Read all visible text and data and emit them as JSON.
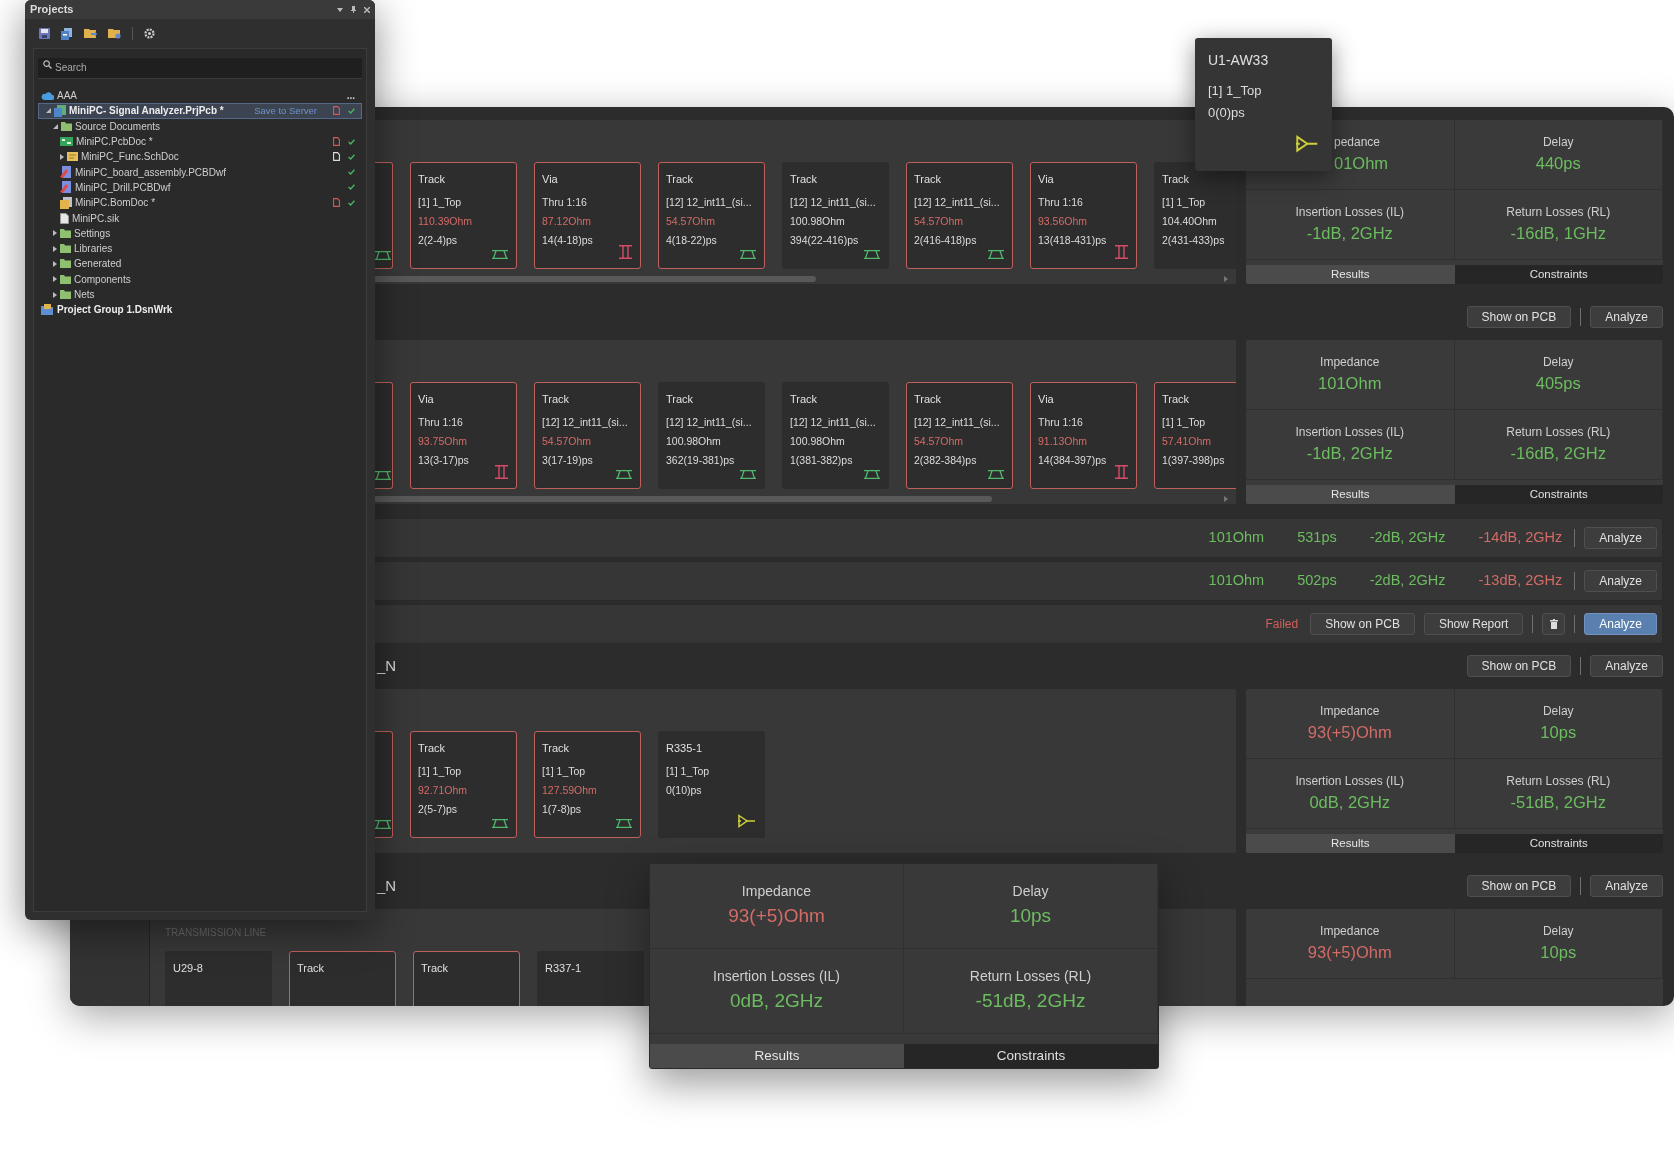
{
  "projects": {
    "title": "Projects",
    "search": {
      "placeholder": "Search"
    },
    "tree": [
      {
        "label": "AAA",
        "kind": "workspace",
        "selected": false,
        "more": "...",
        "children": [
          {
            "label": "MiniPC- Signal Analyzer.PrjPcb *",
            "kind": "project",
            "expanded": true,
            "selected": true,
            "action": "Save to Server",
            "modified": true,
            "synced": true,
            "children": [
              {
                "label": "Source Documents",
                "kind": "folder",
                "expanded": true,
                "selected": false,
                "children": [
                  {
                    "label": "MiniPC.PcbDoc *",
                    "kind": "pcb",
                    "selected": false,
                    "modified": true,
                    "synced": true
                  },
                  {
                    "label": "MiniPC_Func.SchDoc",
                    "kind": "schematic",
                    "expanded": false,
                    "selected": false,
                    "modified": false,
                    "synced": true
                  },
                  {
                    "label": "MiniPC_board_assembly.PCBDwf",
                    "kind": "drawing",
                    "selected": false,
                    "synced": true
                  },
                  {
                    "label": "MiniPC_Drill.PCBDwf",
                    "kind": "drawing",
                    "selected": false,
                    "synced": true
                  },
                  {
                    "label": "MiniPC.BomDoc *",
                    "kind": "bom",
                    "selected": false,
                    "modified": true,
                    "synced": true
                  },
                  {
                    "label": "MiniPC.sik",
                    "kind": "text",
                    "selected": false,
                    "synced": false
                  }
                ]
              },
              {
                "label": "Settings",
                "kind": "folder",
                "expanded": false,
                "selected": false
              },
              {
                "label": "Libraries",
                "kind": "folder",
                "expanded": false,
                "selected": false
              },
              {
                "label": "Generated",
                "kind": "folder",
                "expanded": false,
                "selected": false
              },
              {
                "label": "Components",
                "kind": "folder",
                "expanded": false,
                "selected": false
              },
              {
                "label": "Nets",
                "kind": "folder",
                "expanded": false,
                "selected": false
              }
            ]
          }
        ]
      },
      {
        "label": "Project Group 1.DsnWrk",
        "kind": "group",
        "selected": false
      }
    ]
  },
  "sections": [
    {
      "kind": "detail",
      "scrollbar": true,
      "cards": [
        {
          "cut": true,
          "flagged": true,
          "kind": "track"
        },
        {
          "title": "Track",
          "layer": "[1] 1_Top",
          "impedance": "110.39Ohm",
          "delay": "2(2-4)ps",
          "flagged": true,
          "kind": "track"
        },
        {
          "title": "Via",
          "layer": "Thru 1:16",
          "impedance": "87.12Ohm",
          "delay": "14(4-18)ps",
          "flagged": true,
          "kind": "via"
        },
        {
          "title": "Track",
          "layer": "[12] 12_int11_(si...",
          "impedance": "54.57Ohm",
          "delay": "4(18-22)ps",
          "flagged": true,
          "kind": "track"
        },
        {
          "title": "Track",
          "layer": "[12] 12_int11_(si...",
          "impedance": "100.98Ohm",
          "delay": "394(22-416)ps",
          "flagged": false,
          "kind": "track"
        },
        {
          "title": "Track",
          "layer": "[12] 12_int11_(si...",
          "impedance": "54.57Ohm",
          "delay": "2(416-418)ps",
          "flagged": true,
          "kind": "track"
        },
        {
          "title": "Via",
          "layer": "Thru 1:16",
          "impedance": "93.56Ohm",
          "delay": "13(418-431)ps",
          "flagged": true,
          "kind": "via"
        },
        {
          "title": "Track",
          "layer": "[1] 1_Top",
          "impedance": "104.40Ohm",
          "delay": "2(431-433)ps",
          "flagged": false
        }
      ],
      "results": {
        "metrics": [
          {
            "label": "pedance",
            "value": "01Ohm",
            "failed": false,
            "covered": true
          },
          {
            "label": "Delay",
            "value": "440ps",
            "failed": false,
            "covered": false
          },
          {
            "label": "Insertion Losses (IL)",
            "value": "-1dB, 2GHz",
            "failed": false,
            "covered": false
          },
          {
            "label": "Return Losses (RL)",
            "value": "-16dB, 1GHz",
            "failed": false,
            "covered": false
          }
        ],
        "tabs": [
          {
            "label": "Results",
            "selected": true
          },
          {
            "label": "Constraints",
            "selected": false
          }
        ]
      }
    },
    {
      "kind": "detail",
      "header": {
        "buttons": [
          {
            "kind": "button",
            "label": "Show on PCB",
            "primary": false
          },
          {
            "kind": "separator"
          },
          {
            "kind": "button",
            "label": "Analyze",
            "primary": false
          }
        ]
      },
      "scrollbar": true,
      "cards": [
        {
          "cut": true,
          "flagged": true,
          "kind": "track"
        },
        {
          "title": "Via",
          "layer": "Thru 1:16",
          "impedance": "93.75Ohm",
          "delay": "13(3-17)ps",
          "flagged": true,
          "kind": "via"
        },
        {
          "title": "Track",
          "layer": "[12] 12_int11_(si...",
          "impedance": "54.57Ohm",
          "delay": "3(17-19)ps",
          "flagged": true,
          "kind": "track"
        },
        {
          "title": "Track",
          "layer": "[12] 12_int11_(si...",
          "impedance": "100.98Ohm",
          "delay": "362(19-381)ps",
          "flagged": false,
          "kind": "track"
        },
        {
          "title": "Track",
          "layer": "[12] 12_int11_(si...",
          "impedance": "100.98Ohm",
          "delay": "1(381-382)ps",
          "flagged": false,
          "kind": "track"
        },
        {
          "title": "Track",
          "layer": "[12] 12_int11_(si...",
          "impedance": "54.57Ohm",
          "delay": "2(382-384)ps",
          "flagged": true,
          "kind": "track"
        },
        {
          "title": "Via",
          "layer": "Thru 1:16",
          "impedance": "91.13Ohm",
          "delay": "14(384-397)ps",
          "flagged": true,
          "kind": "via"
        },
        {
          "title": "Track",
          "layer": "[1] 1_Top",
          "impedance": "57.41Ohm",
          "delay": "1(397-398)ps",
          "flagged": true
        }
      ],
      "results": {
        "metrics": [
          {
            "label": "Impedance",
            "value": "101Ohm",
            "failed": false,
            "covered": false
          },
          {
            "label": "Delay",
            "value": "405ps",
            "failed": false,
            "covered": false
          },
          {
            "label": "Insertion Losses (IL)",
            "value": "-1dB, 2GHz",
            "failed": false,
            "covered": false
          },
          {
            "label": "Return Losses (RL)",
            "value": "-16dB, 2GHz",
            "failed": false,
            "covered": false
          }
        ],
        "tabs": [
          {
            "label": "Results",
            "selected": true
          },
          {
            "label": "Constraints",
            "selected": false
          }
        ]
      }
    },
    {
      "kind": "summary",
      "values": [
        {
          "text": "101Ohm",
          "failed": false
        },
        {
          "text": "531ps",
          "failed": false
        },
        {
          "text": "-2dB, 2GHz",
          "failed": false
        },
        {
          "text": "-14dB, 2GHz",
          "failed": true
        }
      ],
      "buttons": [
        {
          "kind": "separator"
        },
        {
          "kind": "button",
          "label": "Analyze",
          "primary": false
        }
      ]
    },
    {
      "kind": "summary",
      "values": [
        {
          "text": "101Ohm",
          "failed": false
        },
        {
          "text": "502ps",
          "failed": false
        },
        {
          "text": "-2dB, 2GHz",
          "failed": false
        },
        {
          "text": "-13dB, 2GHz",
          "failed": true
        }
      ],
      "buttons": [
        {
          "kind": "separator"
        },
        {
          "kind": "button",
          "label": "Analyze",
          "primary": false
        }
      ]
    },
    {
      "kind": "status",
      "status_text": "Failed",
      "buttons": [
        {
          "kind": "button",
          "label": "Show on PCB",
          "primary": false
        },
        {
          "kind": "button",
          "label": "Show Report",
          "primary": false
        },
        {
          "kind": "separator"
        },
        {
          "kind": "icon"
        },
        {
          "kind": "separator"
        },
        {
          "kind": "button",
          "label": "Analyze",
          "primary": true
        }
      ]
    },
    {
      "kind": "detail",
      "header": {
        "title": "_N",
        "buttons": [
          {
            "kind": "button",
            "label": "Show on PCB",
            "primary": false
          },
          {
            "kind": "separator"
          },
          {
            "kind": "button",
            "label": "Analyze",
            "primary": false
          }
        ]
      },
      "scrollbar": false,
      "cards": [
        {
          "cut": true,
          "flagged": true,
          "kind": "track"
        },
        {
          "title": "Track",
          "layer": "[1] 1_Top",
          "impedance": "92.71Ohm",
          "delay": "2(5-7)ps",
          "flagged": true,
          "kind": "track"
        },
        {
          "title": "Track",
          "layer": "[1] 1_Top",
          "impedance": "127.59Ohm",
          "delay": "1(7-8)ps",
          "flagged": true,
          "kind": "track"
        },
        {
          "title": "R335-1",
          "layer": "[1] 1_Top",
          "delay": "0(10)ps",
          "flagged": false,
          "kind": "pin"
        }
      ],
      "results": {
        "metrics": [
          {
            "label": "Impedance",
            "value": "93(+5)Ohm",
            "failed": true,
            "covered": false
          },
          {
            "label": "Delay",
            "value": "10ps",
            "failed": false,
            "covered": false
          },
          {
            "label": "Insertion Losses (IL)",
            "value": "0dB, 2GHz",
            "failed": false,
            "covered": false
          },
          {
            "label": "Return Losses (RL)",
            "value": "-51dB, 2GHz",
            "failed": false,
            "covered": false
          }
        ],
        "tabs": [
          {
            "label": "Results",
            "selected": true
          },
          {
            "label": "Constraints",
            "selected": false
          }
        ]
      }
    },
    {
      "kind": "detail",
      "header": {
        "title": "_N",
        "buttons": [
          {
            "kind": "button",
            "label": "Show on PCB",
            "primary": false
          },
          {
            "kind": "separator"
          },
          {
            "kind": "button",
            "label": "Analyze",
            "primary": false
          }
        ]
      },
      "area_label": "TRANSMISSION LINE",
      "cards": [
        {
          "title": "U29-8",
          "flagged": false
        },
        {
          "title": "Track",
          "flagged": true
        },
        {
          "title": "Track",
          "flagged": true
        },
        {
          "title": "R337-1",
          "flagged": false
        }
      ],
      "results": {
        "metrics": [
          {
            "label": "Impedance",
            "value": "93(+5)Ohm",
            "failed": true,
            "covered": false
          },
          {
            "label": "Delay",
            "value": "10ps",
            "failed": false,
            "covered": false
          }
        ]
      }
    }
  ],
  "tooltip": {
    "title": "U1-AW33",
    "layer": "[1] 1_Top",
    "delay": "0(0)ps",
    "kind": "pin"
  },
  "popover": {
    "metrics": [
      {
        "label": "Impedance",
        "value": "93(+5)Ohm",
        "failed": true,
        "covered": false
      },
      {
        "label": "Delay",
        "value": "10ps",
        "failed": false,
        "covered": false
      },
      {
        "label": "Insertion Losses (IL)",
        "value": "0dB, 2GHz",
        "failed": false,
        "covered": false
      },
      {
        "label": "Return Losses (RL)",
        "value": "-51dB, 2GHz",
        "failed": false,
        "covered": false
      }
    ],
    "tabs": [
      {
        "label": "Results",
        "selected": true
      },
      {
        "label": "Constraints",
        "selected": false
      }
    ]
  }
}
